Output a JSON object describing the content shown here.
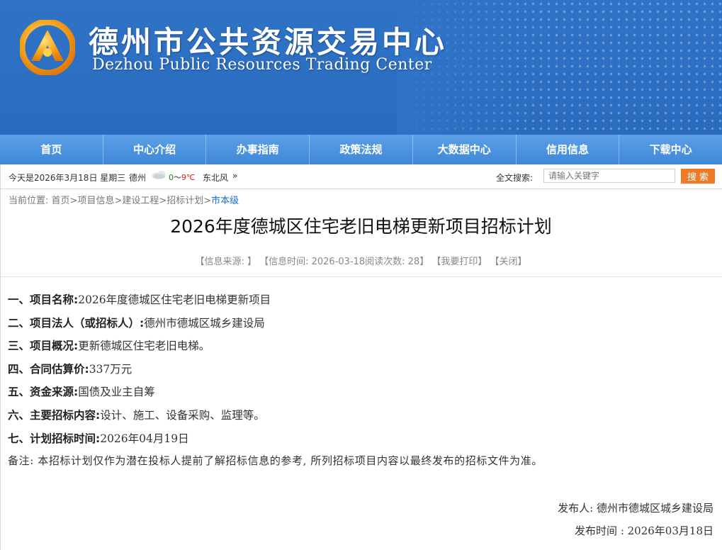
{
  "header": {
    "title_cn": "德州市公共资源交易中心",
    "title_en": "Dezhou Public Resources Trading Center",
    "logo_icon": "triangle-ring-logo-icon"
  },
  "nav": [
    "首页",
    "中心介绍",
    "办事指南",
    "政策法规",
    "大数据中心",
    "信用信息",
    "下载中心"
  ],
  "infobar": {
    "date": "今天是2026年3月18日 星期三",
    "city": "德州",
    "weather_icon": "cloud-icon",
    "temp_low": "0",
    "temp_sep": "～",
    "temp_high": "9℃",
    "wind": "东北风",
    "more": "»",
    "search_label": "全文搜索:",
    "search_placeholder": "请输入关键字",
    "search_button": "搜 索"
  },
  "breadcrumb": {
    "prefix": "当前位置:",
    "items": [
      "首页>",
      "项目信息>",
      "建设工程>",
      "招标计划>"
    ],
    "current": "市本级"
  },
  "article": {
    "title": "2026年度德城区住宅老旧电梯更新项目招标计划",
    "meta": {
      "source": "【信息来源: 】",
      "time": "【信息时间: 2026-03-18阅读次数: 28】",
      "print": "【我要打印】",
      "close": "【关闭】"
    },
    "lines": [
      {
        "label": "一、项目名称:",
        "value": "2026年度德城区住宅老旧电梯更新项目"
      },
      {
        "label": "二、项目法人（或招标人）:",
        "value": "德州市德城区城乡建设局"
      },
      {
        "label": "三、项目概况:",
        "value": "更新德城区住宅老旧电梯。"
      },
      {
        "label": "四、合同估算价:",
        "value": "337万元"
      },
      {
        "label": "五、资金来源:",
        "value": "国债及业主自筹"
      },
      {
        "label": "六、主要招标内容:",
        "value": "设计、施工、设备采购、监理等。"
      },
      {
        "label": "七、计划招标时间:",
        "value": "2026年04月19日"
      }
    ],
    "note": "备注: 本招标计划仅作为潜在投标人提前了解招标信息的参考, 所列招标项目内容以最终发布的招标文件为准。",
    "publisher": "发布人: 德州市德城区城乡建设局",
    "publish_time": "发布时间 : 2026年03月18日"
  },
  "colors": {
    "banner": "#2f73c6",
    "nav": "#4a90de",
    "search_button": "#f07b27",
    "current_link": "#1a6fc9"
  }
}
